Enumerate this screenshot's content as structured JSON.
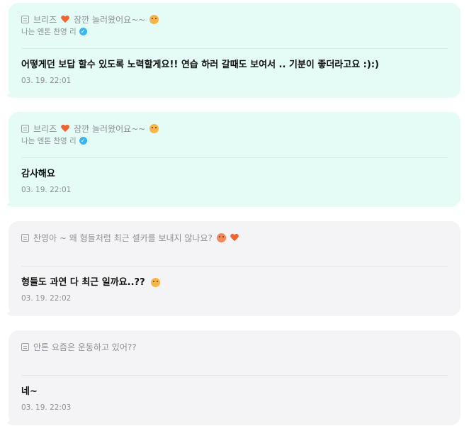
{
  "messages": [
    {
      "kind": "artist",
      "quote_prefix": "브리즈",
      "quote_text": "잠깐 놀러왔어요~~",
      "author": "나는 엔톤 찬영 리",
      "text": "어떻게던 보답 할수 있도록 노력할게요!! 연습 하러 갈때도 보여서 .. 기분이 좋더라고요 :):)",
      "time": "03. 19. 22:01"
    },
    {
      "kind": "artist",
      "quote_prefix": "브리즈",
      "quote_text": "잠깐 놀러왔어요~~",
      "author": "나는 엔톤 찬영 리",
      "text": "감사해요",
      "time": "03. 19. 22:01"
    },
    {
      "kind": "fan",
      "quote_text": "찬영아 ~ 왜 형들처럼 최근 셀카를 보내지 않나요?",
      "text": "형들도 과연 다 최근 일까요..??",
      "time": "03. 19. 22:02"
    },
    {
      "kind": "fan",
      "quote_text": "안톤 요즘은 운동하고 있어??",
      "text": "네~",
      "time": "03. 19. 22:03"
    }
  ],
  "colors": {
    "artist_bubble": "#e5fcf6",
    "fan_bubble": "#f4f4f6",
    "heart": "#f0642f",
    "verified": "#3ab4f2"
  },
  "icons": {
    "quote": "quote-icon",
    "heart": "heart-icon",
    "verified": "verified-badge-icon",
    "emoji": "emoji-icon"
  }
}
